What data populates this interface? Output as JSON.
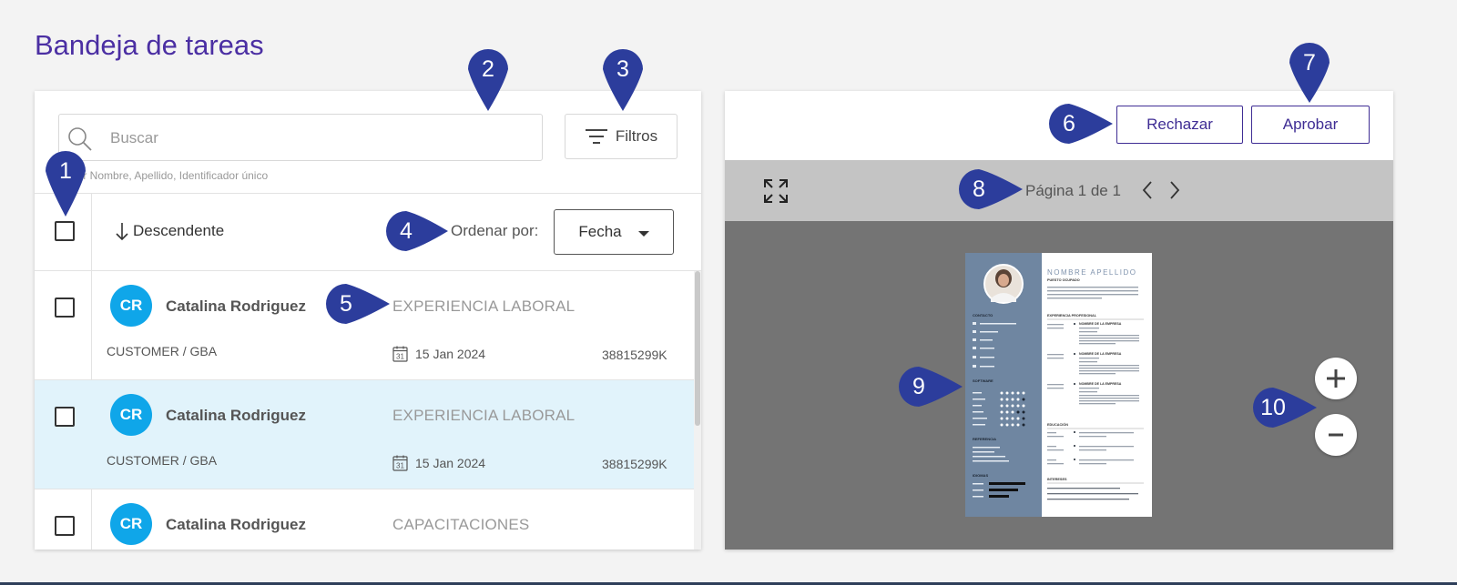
{
  "page": {
    "title": "Bandeja de tareas"
  },
  "search": {
    "placeholder": "Buscar",
    "hint": "ar por Nombre, Apellido, Identificador único"
  },
  "filters": {
    "label": "Filtros"
  },
  "sort": {
    "direction": "Descendente",
    "label": "Ordenar por:",
    "selected": "Fecha"
  },
  "tasks": [
    {
      "initials": "CR",
      "name": "Catalina Rodriguez",
      "category": "EXPERIENCIA LABORAL",
      "org": "CUSTOMER / GBA",
      "date": "15 Jan 2024",
      "id": "38815299K",
      "selected": false
    },
    {
      "initials": "CR",
      "name": "Catalina Rodriguez",
      "category": "EXPERIENCIA LABORAL",
      "org": "CUSTOMER / GBA",
      "date": "15 Jan 2024",
      "id": "38815299K",
      "selected": true
    },
    {
      "initials": "CR",
      "name": "Catalina Rodriguez",
      "category": "CAPACITACIONES",
      "org": "",
      "date": "",
      "id": "",
      "selected": false
    }
  ],
  "actions": {
    "reject": "Rechazar",
    "approve": "Aprobar"
  },
  "viewer": {
    "page_info": "Página 1 de 1",
    "calendar_day": "31",
    "document": {
      "name": "NOMBRE APELLIDO",
      "role": "PUESTO OCUPADO",
      "sidebar_sections": [
        "CONTACTO",
        "SOFTWARE",
        "REFERENCIA",
        "IDIOMAS"
      ],
      "main_sections": [
        "EXPERIENCIA PROFESIONAL",
        "EDUCACIÓN",
        "INTERESES"
      ],
      "job_title": "NOMBRE DE LA EMPRESA"
    }
  },
  "callouts": [
    "1",
    "2",
    "3",
    "4",
    "5",
    "6",
    "7",
    "8",
    "9",
    "10"
  ],
  "colors": {
    "title": "#4b2fa3",
    "accent": "#3f2d94",
    "avatar": "#0fa6e9",
    "selected_row": "#e1f3fb",
    "callout": "#2c3d9c",
    "cv_sidebar": "#6f86a1"
  }
}
